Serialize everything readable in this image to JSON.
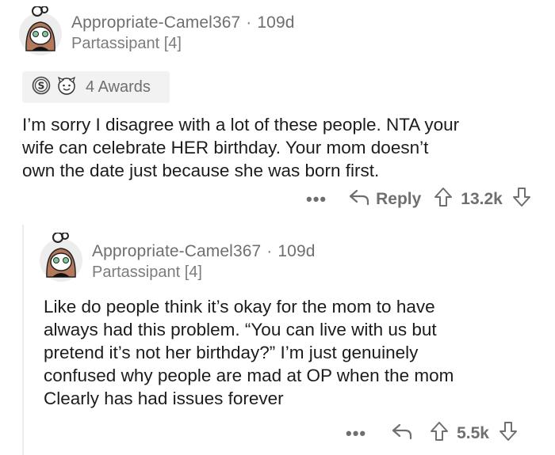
{
  "comment": {
    "username": "Appropriate-Camel367",
    "separator": "·",
    "age": "109d",
    "flair": "Partassipant [4]",
    "awards_label": "4 Awards",
    "body_lines": [
      "I’m sorry I disagree with a lot of these people. NTA your",
      "wife can celebrate HER birthday. Your mom doesn’t",
      "own the date just because she was born first."
    ],
    "more": "•••",
    "reply_label": "Reply",
    "score": "13.2k"
  },
  "reply": {
    "username": "Appropriate-Camel367",
    "separator": "·",
    "age": "109d",
    "flair": "Partassipant [4]",
    "body_lines": [
      "Like do people think it’s okay for the mom to have",
      "always had this problem. “You can live with us but",
      "pretend it’s not her birthday?” I’m just genuinely",
      "confused why people are mad at OP when the mom",
      "Clearly has had issues forever"
    ],
    "more": "•••",
    "score": "5.5k"
  },
  "colors": {
    "text": "#1c1c1c",
    "meta": "#6f6f6f",
    "award_bg": "#f2f2f2",
    "avatar_hair": "#b4795a",
    "avatar_eye": "#7fc99a"
  },
  "icons": [
    "avatar-icon",
    "silver-award-icon",
    "wholesome-award-icon",
    "reply-arrow-icon",
    "upvote-icon",
    "downvote-icon"
  ]
}
